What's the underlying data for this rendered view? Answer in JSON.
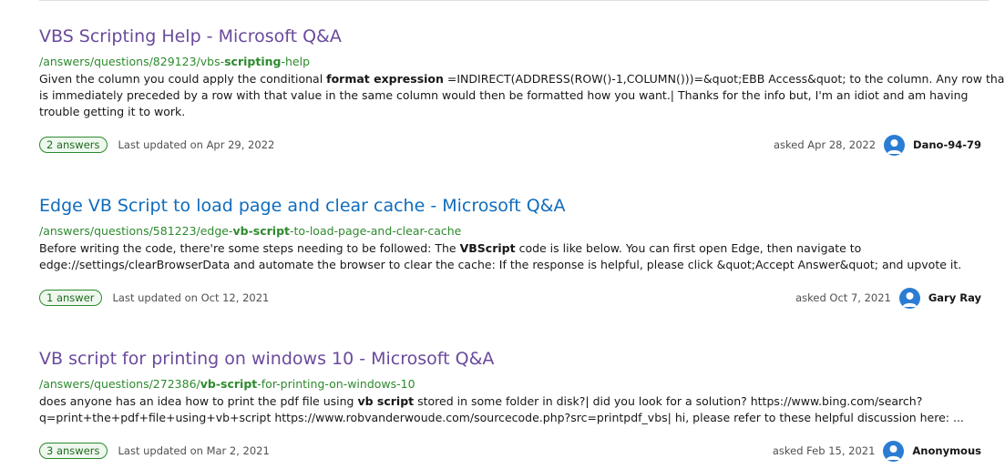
{
  "results": [
    {
      "title": "VBS Scripting Help - Microsoft Q&A",
      "url_pre": "/answers/questions/829123/vbs-",
      "url_bold": "scripting",
      "url_post": "-help",
      "snippet_l1_pre": "Given the column you could apply the conditional ",
      "snippet_l1_bold": "format expression",
      "snippet_l1_post": " =INDIRECT(ADDRESS(ROW()-1,COLUMN()))=&quot;EBB Access&quot; to the column. Any row that",
      "snippet_l2": "is immediately preceded by a row with that value in the same column would then be formatted how you want.| Thanks for the info but, I'm an idiot and am having",
      "snippet_l3": "trouble getting it to work.",
      "answers": "2 answers",
      "updated": "Last updated on Apr 29, 2022",
      "asked": "asked Apr 28, 2022",
      "user": "Dano-94-79",
      "visited": true
    },
    {
      "title": "Edge VB Script to load page and clear cache - Microsoft Q&A",
      "url_pre": "/answers/questions/581223/edge-",
      "url_bold": "vb-script",
      "url_post": "-to-load-page-and-clear-cache",
      "snippet_l1_pre": "Before writing the code, there're some steps needing to be followed: The ",
      "snippet_l1_bold": "VBScript",
      "snippet_l1_post": " code is like below. You can first open Edge, then navigate to",
      "snippet_l2": "edge://settings/clearBrowserData and automate the browser to clear the cache: If the response is helpful, please click &quot;Accept Answer&quot; and upvote it.",
      "answers": "1 answer",
      "updated": "Last updated on Oct 12, 2021",
      "asked": "asked Oct 7, 2021",
      "user": "Gary Ray",
      "visited": false
    },
    {
      "title": "VB script for printing on windows 10 - Microsoft Q&A",
      "url_pre": "/answers/questions/272386/",
      "url_bold": "vb-script",
      "url_post": "-for-printing-on-windows-10",
      "snippet_l1_pre": "does anyone has an idea how to print the pdf file using ",
      "snippet_l1_bold": "vb script",
      "snippet_l1_post": " stored in some folder in disk?| did you look for a solution? https://www.bing.com/search?",
      "snippet_l2": "q=print+the+pdf+file+using+vb+script https://www.robvanderwoude.com/sourcecode.php?src=printpdf_vbs| hi, please refer to these helpful discussion here: ...",
      "answers": "3 answers",
      "updated": "Last updated on Mar 2, 2021",
      "asked": "asked Feb 15, 2021",
      "user": "Anonymous",
      "visited": true
    }
  ]
}
